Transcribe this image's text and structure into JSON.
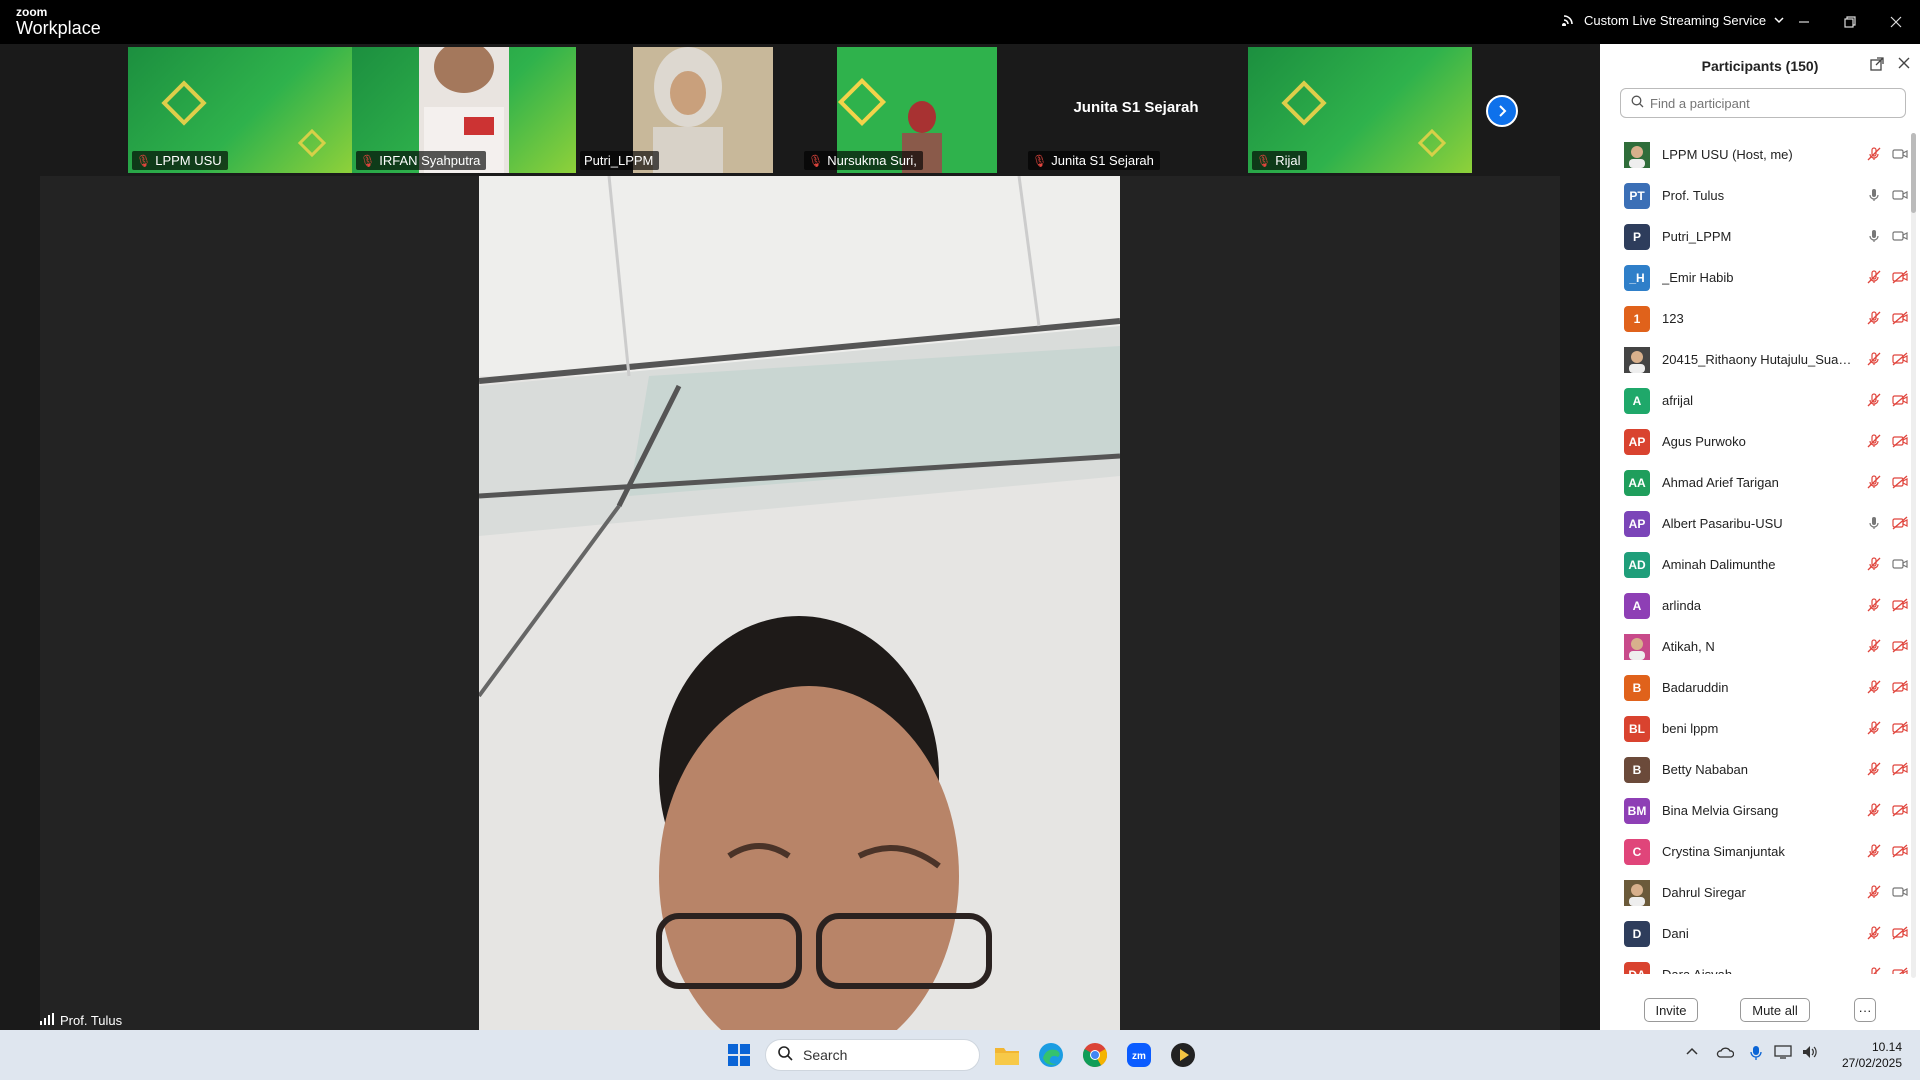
{
  "app": {
    "logo_top": "zoom",
    "logo_bottom": "Workplace",
    "streaming_label": "Custom Live Streaming Service"
  },
  "strip": {
    "tiles": [
      {
        "name": "LPPM USU",
        "muted": true
      },
      {
        "name": "IRFAN Syahputra",
        "muted": true
      },
      {
        "name": "Putri_LPPM",
        "muted": false
      },
      {
        "name": "Nursukma Suri,",
        "muted": true
      },
      {
        "name": "Junita S1 Sejarah",
        "muted": true,
        "display_text": "Junita S1 Sejarah"
      },
      {
        "name": "Rijal",
        "muted": true
      }
    ]
  },
  "speaker": {
    "name": "Prof. Tulus"
  },
  "participants": {
    "title": "Participants (150)",
    "search_placeholder": "Find a participant",
    "list": [
      {
        "initials": "",
        "name": "LPPM USU (Host, me)",
        "color": "#2f6d3a",
        "photo": true,
        "mic": "off",
        "video": "on"
      },
      {
        "initials": "PT",
        "name": "Prof. Tulus",
        "color": "#3b6fb6",
        "mic": "on",
        "video": "on"
      },
      {
        "initials": "P",
        "name": "Putri_LPPM",
        "color": "#2e3d5c",
        "mic": "on",
        "video": "on"
      },
      {
        "initials": "_H",
        "name": "_Emir Habib",
        "color": "#2f7fc9",
        "mic": "off",
        "video": "off"
      },
      {
        "initials": "1",
        "name": "123",
        "color": "#e0621b",
        "mic": "off",
        "video": "off"
      },
      {
        "initials": "",
        "name": "20415_Rithaony Hutajulu_Suara...",
        "color": "#444",
        "photo": true,
        "mic": "off",
        "video": "off"
      },
      {
        "initials": "A",
        "name": "afrijal",
        "color": "#1fa86a",
        "mic": "off",
        "video": "off"
      },
      {
        "initials": "AP",
        "name": "Agus Purwoko",
        "color": "#d9432f",
        "mic": "off",
        "video": "off"
      },
      {
        "initials": "AA",
        "name": "Ahmad Arief Tarigan",
        "color": "#1f9e5c",
        "mic": "off",
        "video": "off"
      },
      {
        "initials": "AP",
        "name": "Albert Pasaribu-USU",
        "color": "#7b45b8",
        "mic": "on",
        "video": "off"
      },
      {
        "initials": "AD",
        "name": "Aminah Dalimunthe",
        "color": "#1f9e7a",
        "mic": "off",
        "video": "on"
      },
      {
        "initials": "A",
        "name": "arlinda",
        "color": "#8e3fb5",
        "mic": "off",
        "video": "off"
      },
      {
        "initials": "",
        "name": "Atikah, N",
        "color": "#c84a8a",
        "photo": true,
        "mic": "off",
        "video": "off"
      },
      {
        "initials": "B",
        "name": "Badaruddin",
        "color": "#e0621b",
        "mic": "off",
        "video": "off"
      },
      {
        "initials": "BL",
        "name": "beni lppm",
        "color": "#d9432f",
        "mic": "off",
        "video": "off"
      },
      {
        "initials": "B",
        "name": "Betty Nababan",
        "color": "#6b4a3a",
        "mic": "off",
        "video": "off"
      },
      {
        "initials": "BM",
        "name": "Bina Melvia Girsang",
        "color": "#8e3fb5",
        "mic": "off",
        "video": "off"
      },
      {
        "initials": "C",
        "name": "Crystina Simanjuntak",
        "color": "#e0457a",
        "mic": "off",
        "video": "off"
      },
      {
        "initials": "",
        "name": "Dahrul Siregar",
        "color": "#6b5a3a",
        "photo": true,
        "mic": "off",
        "video": "on"
      },
      {
        "initials": "D",
        "name": "Dani",
        "color": "#2e3d5c",
        "mic": "off",
        "video": "off"
      },
      {
        "initials": "DA",
        "name": "Dara Aisyah",
        "color": "#d9432f",
        "mic": "off",
        "video": "off"
      }
    ],
    "invite_label": "Invite",
    "mute_all_label": "Mute all",
    "more_label": "···"
  },
  "taskbar": {
    "search_label": "Search",
    "time": "10.14",
    "date": "27/02/2025"
  },
  "colors": {
    "accent": "#0e71eb",
    "muted_red": "#e0453d",
    "strip_green": "#2fb24c"
  }
}
